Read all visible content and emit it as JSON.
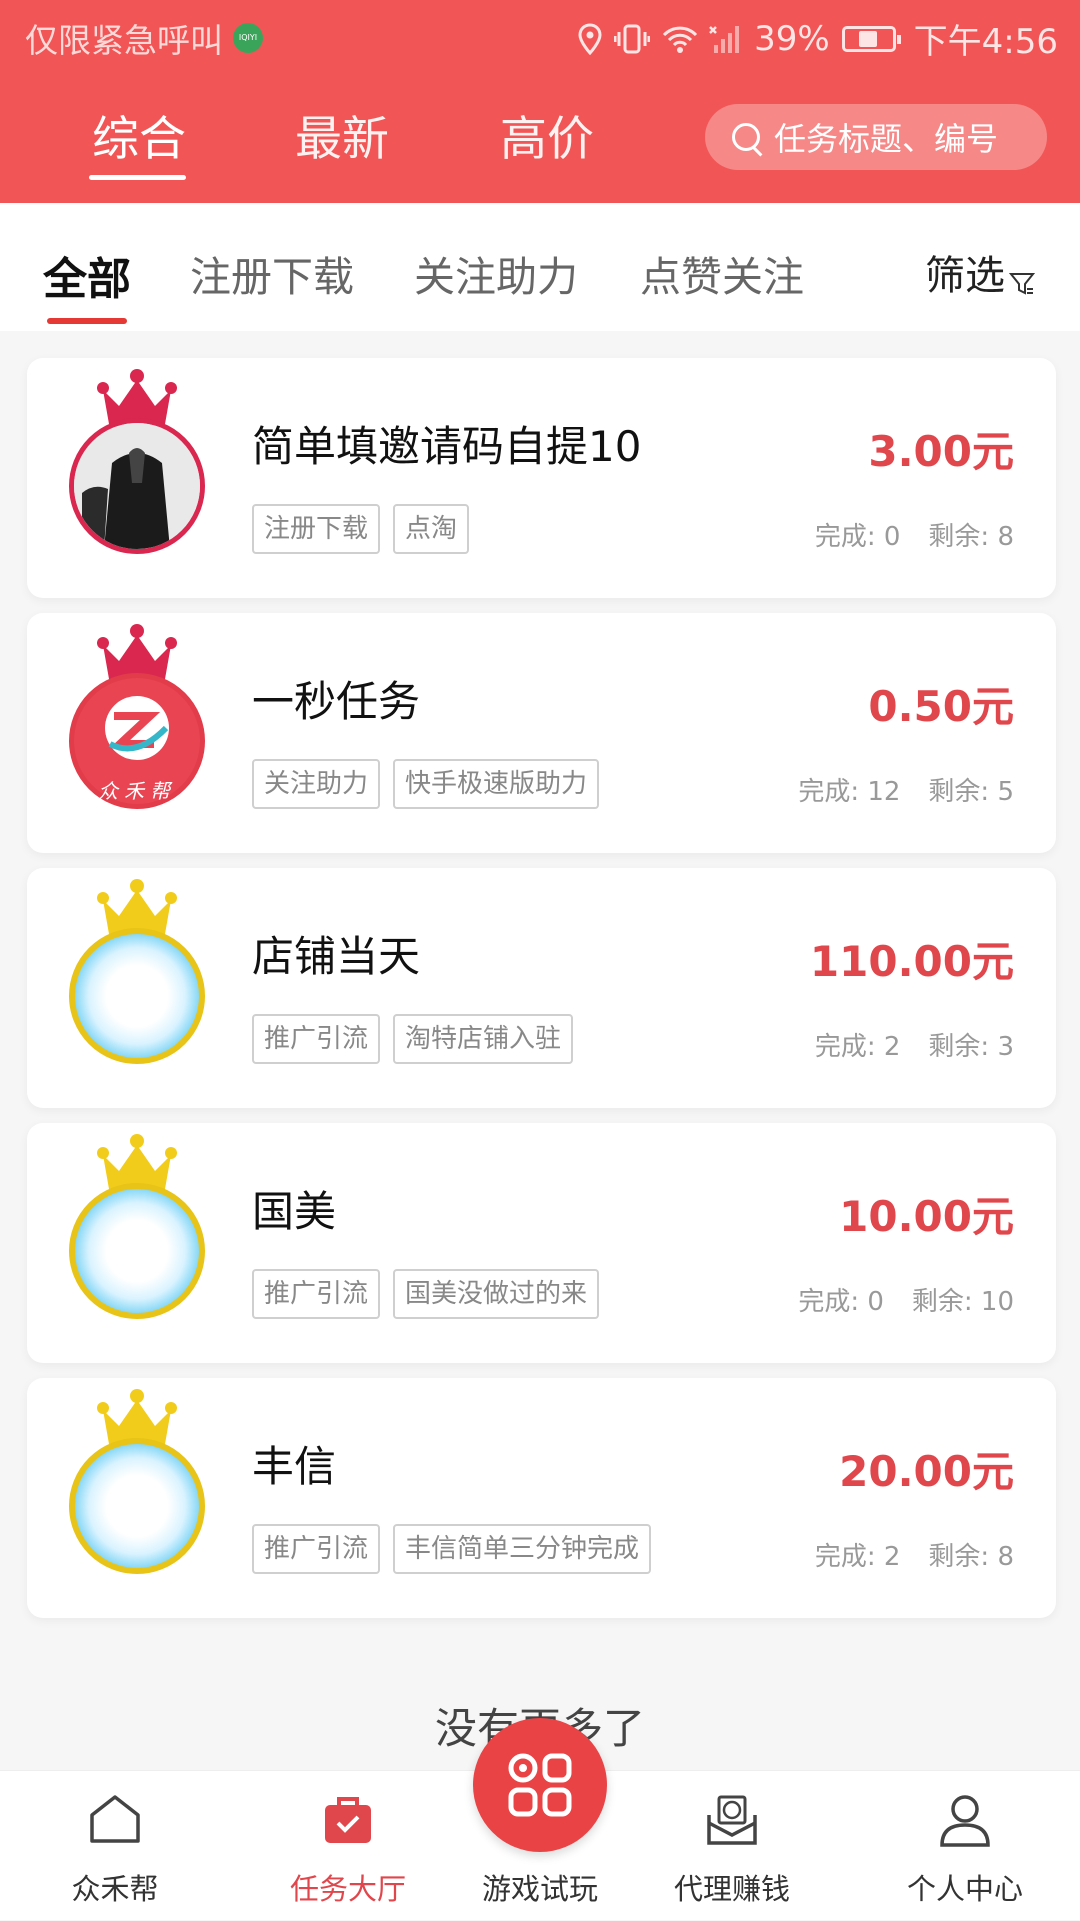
{
  "status_bar": {
    "carrier": "仅限紧急呼叫",
    "app_badge": "IQIYI",
    "battery_percent": "39%",
    "battery_level": 0.39,
    "time": "下午4:56"
  },
  "header": {
    "tabs": [
      "综合",
      "最新",
      "高价"
    ],
    "active_tab": "综合",
    "search_placeholder": "任务标题、编号"
  },
  "categories": {
    "items": [
      "全部",
      "注册下载",
      "关注助力",
      "点赞关注"
    ],
    "active": "全部",
    "filter_label": "筛选"
  },
  "tasks": [
    {
      "title": "简单填邀请码自提10",
      "price": "3.00元",
      "tags": [
        "注册下载",
        "点淘"
      ],
      "done_label": "完成: 0",
      "remain_label": "剩余: 8",
      "avatar": "photo",
      "crown": "red"
    },
    {
      "title": "一秒任务",
      "price": "0.50元",
      "tags": [
        "关注助力",
        "快手极速版助力"
      ],
      "done_label": "完成: 12",
      "remain_label": "剩余: 5",
      "avatar": "logo",
      "logo_text": "众禾帮",
      "crown": "red"
    },
    {
      "title": "店铺当天",
      "price": "110.00元",
      "tags": [
        "推广引流",
        "淘特店铺入驻"
      ],
      "done_label": "完成: 2",
      "remain_label": "剩余: 3",
      "avatar": "gold",
      "crown": "gold"
    },
    {
      "title": "国美",
      "price": "10.00元",
      "tags": [
        "推广引流",
        "国美没做过的来"
      ],
      "done_label": "完成: 0",
      "remain_label": "剩余: 10",
      "avatar": "gold",
      "crown": "gold"
    },
    {
      "title": "丰信",
      "price": "20.00元",
      "tags": [
        "推广引流",
        "丰信简单三分钟完成"
      ],
      "done_label": "完成: 2",
      "remain_label": "剩余: 8",
      "avatar": "gold",
      "crown": "gold"
    }
  ],
  "no_more_text": "没有更多了",
  "bottom_nav": {
    "items": [
      {
        "label": "众禾帮",
        "icon": "home-icon"
      },
      {
        "label": "任务大厅",
        "icon": "task-bag-icon"
      },
      {
        "label": "游戏试玩",
        "icon": "grid-icon"
      },
      {
        "label": "代理赚钱",
        "icon": "money-envelope-icon"
      },
      {
        "label": "个人中心",
        "icon": "person-icon"
      }
    ],
    "active": "任务大厅"
  },
  "colors": {
    "brand": "#f25555",
    "price": "#e0474c",
    "crown_red": "#d9274f",
    "crown_gold": "#f2cc1b"
  }
}
